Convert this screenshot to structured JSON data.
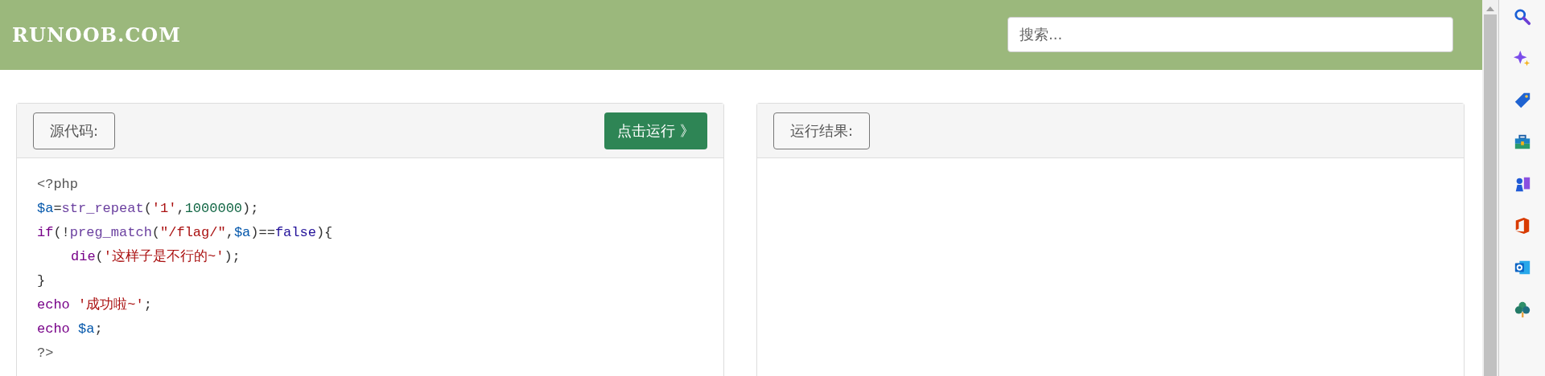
{
  "header": {
    "logo": "RUNOOB.COM",
    "search": {
      "placeholder": "搜索..."
    }
  },
  "source_panel": {
    "label": "源代码:",
    "run_button": "点击运行 》",
    "code_lines": [
      {
        "kind": "plain",
        "tokens": [
          {
            "kind": "meta",
            "text": "<?php"
          }
        ]
      },
      {
        "kind": "plain",
        "tokens": [
          {
            "kind": "variable",
            "text": "$a"
          },
          {
            "kind": "punct",
            "text": "="
          },
          {
            "kind": "builtin",
            "text": "str_repeat"
          },
          {
            "kind": "punct",
            "text": "("
          },
          {
            "kind": "string",
            "text": "'1'"
          },
          {
            "kind": "punct",
            "text": ","
          },
          {
            "kind": "number",
            "text": "1000000"
          },
          {
            "kind": "punct",
            "text": ");"
          }
        ]
      },
      {
        "kind": "plain",
        "tokens": [
          {
            "kind": "keyword",
            "text": "if"
          },
          {
            "kind": "punct",
            "text": "(!"
          },
          {
            "kind": "builtin",
            "text": "preg_match"
          },
          {
            "kind": "punct",
            "text": "("
          },
          {
            "kind": "string",
            "text": "\"/flag/\""
          },
          {
            "kind": "punct",
            "text": ","
          },
          {
            "kind": "variable",
            "text": "$a"
          },
          {
            "kind": "punct",
            "text": ")=="
          },
          {
            "kind": "atom",
            "text": "false"
          },
          {
            "kind": "punct",
            "text": "){"
          }
        ]
      },
      {
        "kind": "indented",
        "tokens": [
          {
            "kind": "keyword",
            "text": "die"
          },
          {
            "kind": "punct",
            "text": "("
          },
          {
            "kind": "string",
            "text": "'这样子是不行的~'"
          },
          {
            "kind": "punct",
            "text": ");"
          }
        ]
      },
      {
        "kind": "plain",
        "tokens": [
          {
            "kind": "punct",
            "text": "}"
          }
        ]
      },
      {
        "kind": "plain",
        "tokens": [
          {
            "kind": "keyword",
            "text": "echo "
          },
          {
            "kind": "string",
            "text": "'成功啦~'"
          },
          {
            "kind": "punct",
            "text": ";"
          }
        ]
      },
      {
        "kind": "plain",
        "tokens": [
          {
            "kind": "keyword",
            "text": "echo "
          },
          {
            "kind": "variable",
            "text": "$a"
          },
          {
            "kind": "punct",
            "text": ";"
          }
        ]
      },
      {
        "kind": "plain",
        "tokens": [
          {
            "kind": "meta",
            "text": "?>"
          }
        ]
      }
    ]
  },
  "result_panel": {
    "label": "运行结果:"
  }
}
